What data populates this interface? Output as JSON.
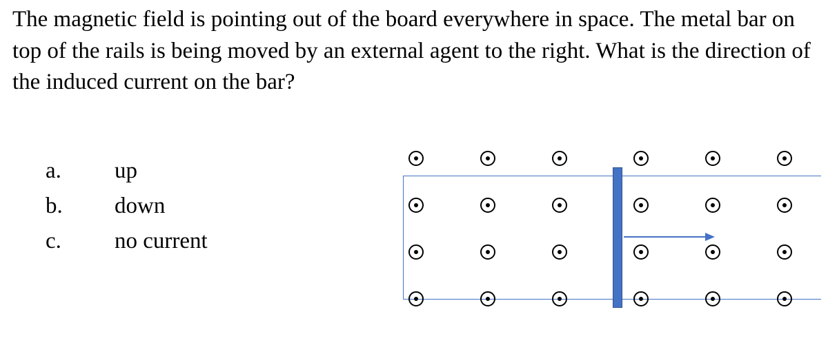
{
  "question": "The magnetic field is pointing out of the board everywhere in space. The metal bar on top of the rails is being moved by an external agent to the right. What is the direction of the induced current on the bar?",
  "options": [
    {
      "letter": "a.",
      "text": "up"
    },
    {
      "letter": "b.",
      "text": "down"
    },
    {
      "letter": "c.",
      "text": "no current"
    }
  ],
  "diagram": {
    "field_symbol": "out-of-page-dot",
    "grid": {
      "rows": 4,
      "cols": 6
    },
    "bar_moving": "right",
    "colors": {
      "rail": "#4472C4",
      "bar": "#4472C4"
    }
  }
}
